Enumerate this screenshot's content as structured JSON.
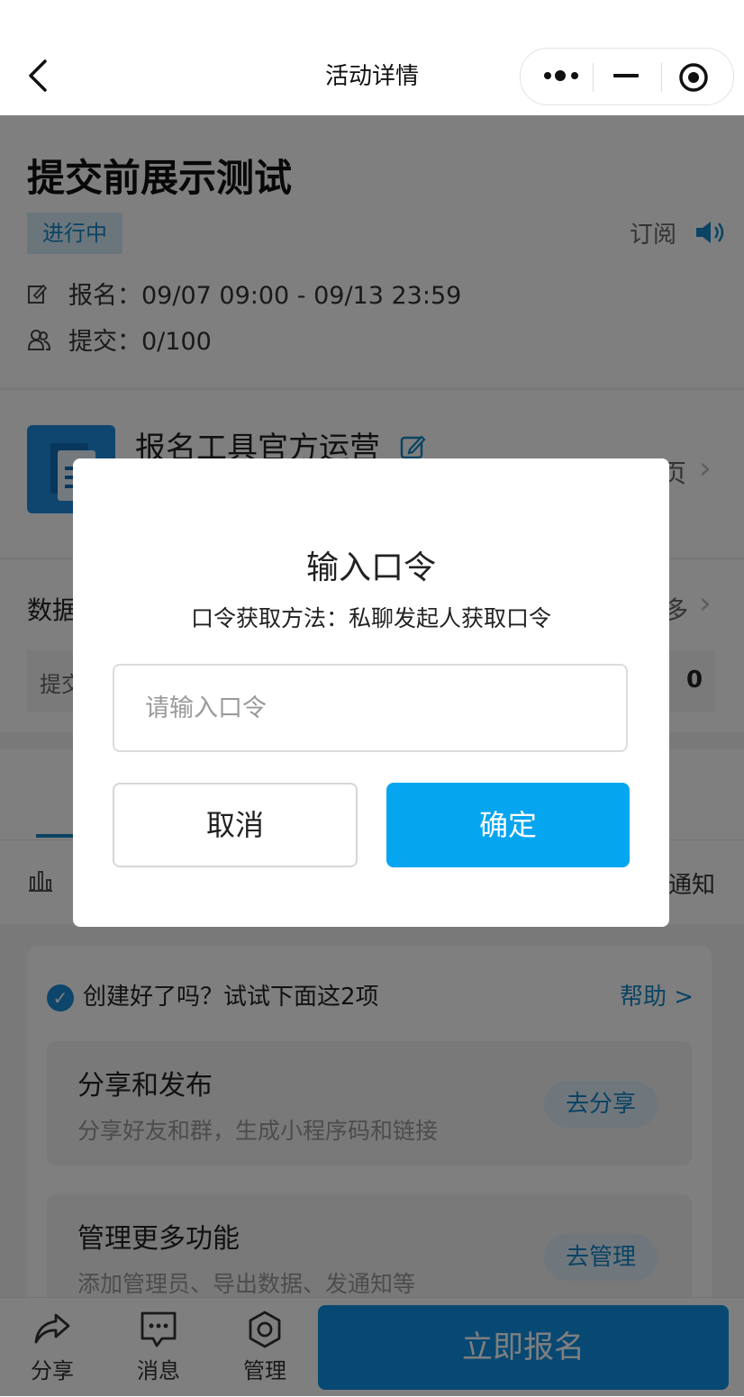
{
  "nav": {
    "title": "活动详情"
  },
  "event": {
    "title": "提交前展示测试",
    "status": "进行中",
    "subscribe": "订阅",
    "signup_period": "报名：09/07 09:00 - 09/13 23:59",
    "submissions": "提交：0/100"
  },
  "org": {
    "name": "报名工具官方运营",
    "partial_right": "页"
  },
  "data_section": {
    "title": "数据",
    "more_partial": "多",
    "stat_label": "提交",
    "stat_value": "0"
  },
  "tabs": {
    "notice_partial": "通知"
  },
  "guide": {
    "heading": "创建好了吗？试试下面这2项",
    "help": "帮助 >",
    "items": [
      {
        "title": "分享和发布",
        "desc": "分享好友和群，生成小程序码和链接",
        "action": "去分享"
      },
      {
        "title": "管理更多功能",
        "desc": "添加管理员、导出数据、发通知等",
        "action": "去管理"
      }
    ]
  },
  "bottom_bar": {
    "share": "分享",
    "message": "消息",
    "manage": "管理",
    "signup": "立即报名"
  },
  "dialog": {
    "title": "输入口令",
    "subtitle": "口令获取方法：私聊发起人获取口令",
    "input_placeholder": "请输入口令",
    "input_value": "",
    "cancel": "取消",
    "confirm": "确定"
  },
  "colors": {
    "accent": "#06a5f0",
    "brand_blue": "#1787c9",
    "overlay": "rgba(0,0,0,0.5)"
  }
}
